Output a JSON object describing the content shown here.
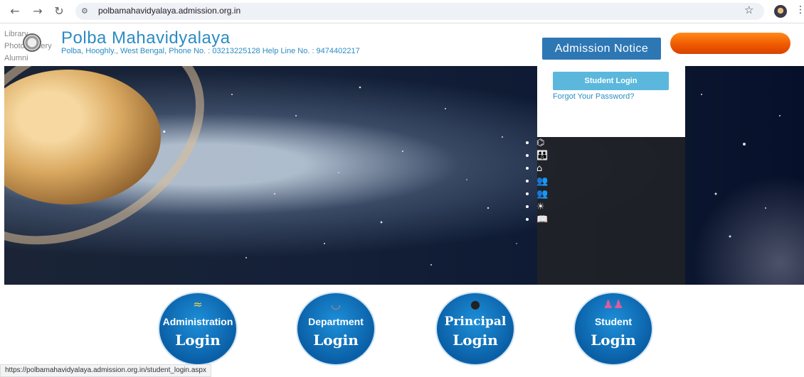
{
  "browser": {
    "url": "polbamahavidyalaya.admission.org.in",
    "status_url": "https://polbamahavidyalaya.admission.org.in/student_login.aspx",
    "icons": [
      "back-icon",
      "forward-icon",
      "reload-icon",
      "site-info-icon",
      "bookmark-star-icon",
      "profile-icon",
      "menu-icon"
    ]
  },
  "header": {
    "side_links": [
      "Library",
      "Photo Gallery",
      "Alumni"
    ],
    "title": "Polba Mahavidyalaya",
    "subtitle": "Polba, Hooghly., West Bengal, Phone No. : 03213225128   Help Line No. : 9474402217",
    "admission_notice": "Admission Notice",
    "accent": "#2b8cc4"
  },
  "login_card": {
    "student_login": "Student Login",
    "forgot": "Forgot Your Password?"
  },
  "side_icons": [
    "telescope-icon",
    "family-icon",
    "building-icon",
    "group-icon",
    "team-icon",
    "lightbulb-icon",
    "book-icon"
  ],
  "logins": [
    {
      "name": "administration",
      "top": "Administration",
      "bottom": "Login",
      "icon": "wave-icon"
    },
    {
      "name": "department",
      "top": "Department",
      "bottom": "Login",
      "icon": "bowl-icon"
    },
    {
      "name": "principal",
      "top": "Principal",
      "bottom": "Login",
      "icon": "person-icon"
    },
    {
      "name": "student",
      "top": "Student",
      "bottom": "Login",
      "icon": "students-icon"
    }
  ]
}
